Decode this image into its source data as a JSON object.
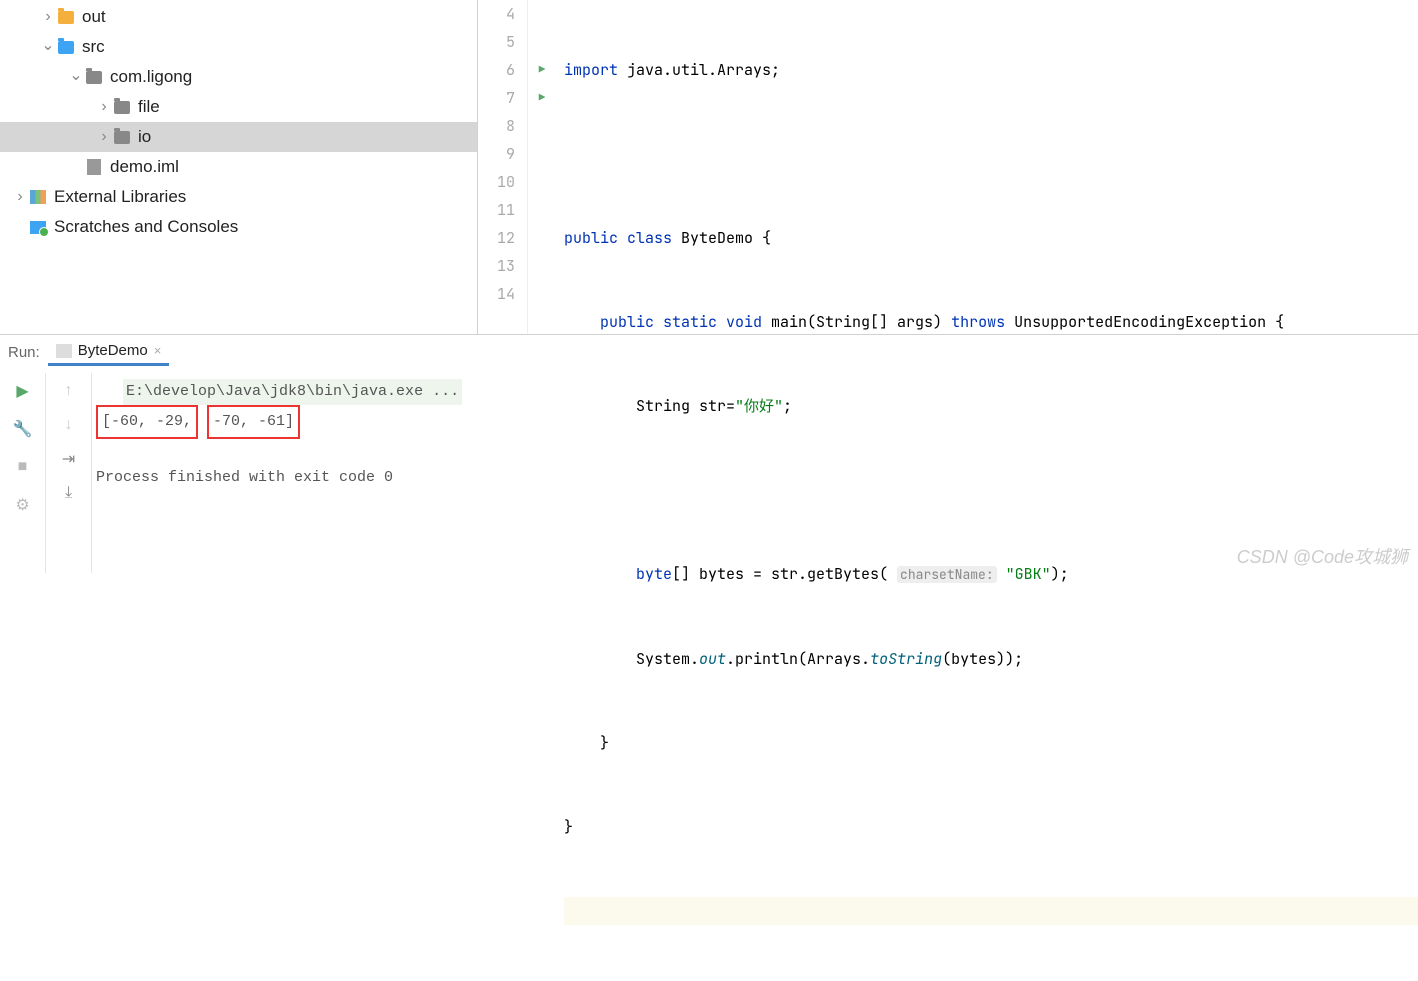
{
  "tree": {
    "out": "out",
    "src": "src",
    "pkg": "com.ligong",
    "file": "file",
    "io": "io",
    "iml": "demo.iml",
    "extlib": "External Libraries",
    "scratch": "Scratches and Consoles"
  },
  "gutter": [
    "4",
    "5",
    "6",
    "7",
    "8",
    "9",
    "10",
    "11",
    "12",
    "13",
    "14"
  ],
  "code": {
    "l4_a": "import",
    "l4_b": " java.util.Arrays;",
    "l6_a": "public class",
    "l6_b": " ByteDemo {",
    "l7_a": "public static void",
    "l7_b": " main",
    "l7_c": "(String[] args) ",
    "l7_d": "throws",
    "l7_e": " UnsupportedEncodingException {",
    "l8_a": "String str=",
    "l8_b": "\"你好\"",
    "l8_c": ";",
    "l10_a": "byte",
    "l10_b": "[] bytes = str.getBytes( ",
    "l10_hint": "charsetName:",
    "l10_c": " ",
    "l10_d": "\"GBK\"",
    "l10_e": ");",
    "l11_a": "System.",
    "l11_b": "out",
    "l11_c": ".println(Arrays.",
    "l11_d": "toString",
    "l11_e": "(bytes));",
    "l12": "}",
    "l13": "}"
  },
  "run": {
    "label": "Run:",
    "tab": "ByteDemo",
    "close": "×",
    "cmd": "E:\\develop\\Java\\jdk8\\bin\\java.exe ...",
    "out1a": "[-60, -29,",
    "out1b": "-70, -61]",
    "exit": "Process finished with exit code 0"
  },
  "watermark": "CSDN @Code攻城狮"
}
